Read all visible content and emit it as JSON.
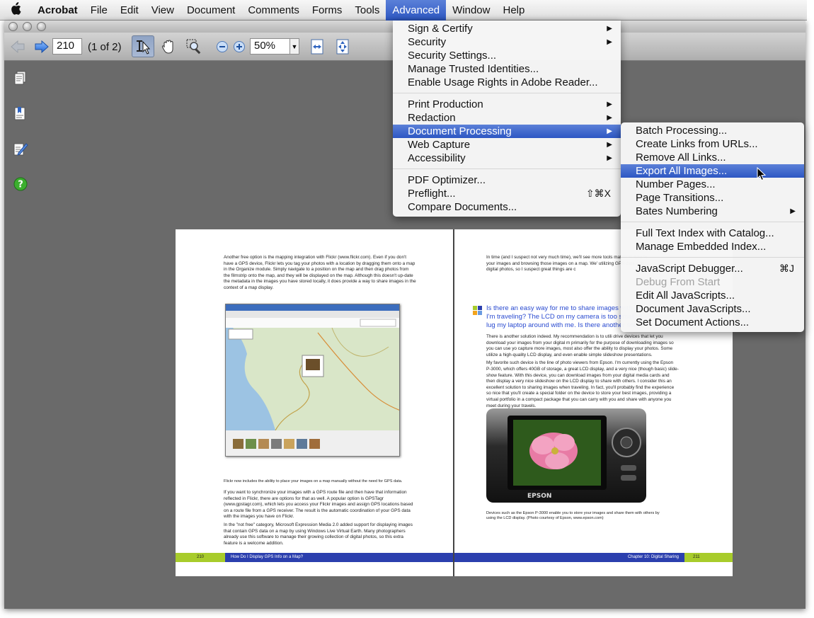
{
  "menubar": {
    "app": "Acrobat",
    "items": [
      "File",
      "Edit",
      "View",
      "Document",
      "Comments",
      "Forms",
      "Tools",
      "Advanced",
      "Window",
      "Help"
    ],
    "active": "Advanced"
  },
  "toolbar": {
    "page_number": "210",
    "page_count": "(1 of 2)",
    "zoom": "50%"
  },
  "advanced_menu": {
    "sign_certify": "Sign & Certify",
    "security": "Security",
    "security_settings": "Security Settings...",
    "manage_trusted": "Manage Trusted Identities...",
    "enable_usage": "Enable Usage Rights in Adobe Reader...",
    "print_production": "Print Production",
    "redaction": "Redaction",
    "document_processing": "Document Processing",
    "web_capture": "Web Capture",
    "accessibility": "Accessibility",
    "pdf_optimizer": "PDF Optimizer...",
    "preflight": "Preflight...",
    "preflight_shortcut": "⇧⌘X",
    "compare_documents": "Compare Documents..."
  },
  "doc_processing_menu": {
    "batch": "Batch Processing...",
    "create_links": "Create Links from URLs...",
    "remove_links": "Remove All Links...",
    "export_images": "Export All Images...",
    "number_pages": "Number Pages...",
    "page_transitions": "Page Transitions...",
    "bates": "Bates Numbering",
    "full_text_index": "Full Text Index with Catalog...",
    "manage_index": "Manage Embedded Index...",
    "js_debugger": "JavaScript Debugger...",
    "js_debugger_shortcut": "⌘J",
    "debug_from_start": "Debug From Start",
    "edit_all_js": "Edit All JavaScripts...",
    "document_js": "Document JavaScripts...",
    "set_doc_actions": "Set Document Actions..."
  },
  "left_page": {
    "para1": "Another free option is the mapping integration with Flickr (www.flickr.com). Even if you don't have a GPS device, Flickr lets you tag your photos with a location by dragging them onto a map in the Organize module. Simply navigate to a position on the map and then drag photos from the filmstrip onto the map, and they will be displayed on the map. Although this doesn't up-date the metadata in the images you have stored locally, it does provide a way to share images in the context of a map display.",
    "caption": "Flickr now includes the ability to place your images on a map manually without the need for GPS data.",
    "para2": "If you want to synchronize your images with a GPS route file and then have that information reflected in Flickr, there are options for that as well. A popular option is GPSTagr (www.gpstagr.com), which lets you access your Flickr images and assign GPS locations based on a route file from a GPS receiver. The result is the automatic coordination of your GPS data with the images you have on Flickr.",
    "para3": "In the \"not free\" category, Microsoft Expression Media 2.0 added support for displaying images that contain GPS data on a map by using Windows Live Virtual Earth. Many photographers already use this software to manage their growing collection of digital photos, so this extra feature is a welcome addition.",
    "footer_page": "210",
    "footer_title": "How Do I Display GPS Info on a Map?"
  },
  "right_page": {
    "para1": "In time (and I suspect not very much time), we'll see more tools mat GPS data to your images and browsing those images on a map. We' utilizing GPS data with digital photos, so I suspect great things are c",
    "callout": "Is there an easy way for me to share images with pe I'm traveling? The LCD on my camera is too small, a lug my laptop around with me. Is there another sol",
    "para2": "There is another solution indeed. My recommendation is to utili drive devices that let you download your images from your digital m primarily for the purpose of downloading images so you can use yo capture more images, most also offer the ability to display your photos. Some utilize a high-quality LCD display, and even enable simple slideshow presentations.",
    "para3": "My favorite such device is the line of photo viewers from Epson. I'm currently using the Epson P-3000, which offers 40GB of storage, a great LCD display, and a very nice (though basic) slide-show feature. With this device, you can download images from your digital media cards and then display a very nice slideshow on the LCD display to share with others. I consider this an excellent solution to sharing images when traveling. In fact, you'll probably find the experience so nice that you'll create a special folder on the device to store your best images, providing a virtual portfolio in a compact package that you can carry with you and share with anyone you meet during your travels.",
    "caption": "Devices such as the Epson P-3000 enable you to store your images and share them with others by using the LCD display. (Photo courtesy of Epson, www.epson.com)",
    "camera_brand": "EPSON",
    "footer_chapter": "Chapter 10: Digital Sharing",
    "footer_page": "211"
  },
  "colors": {
    "menu_highlight": "#2d57c3",
    "footer_lime": "#a8cc2b",
    "footer_navy": "#2b3fae",
    "callout_blue": "#2a4bd0"
  }
}
